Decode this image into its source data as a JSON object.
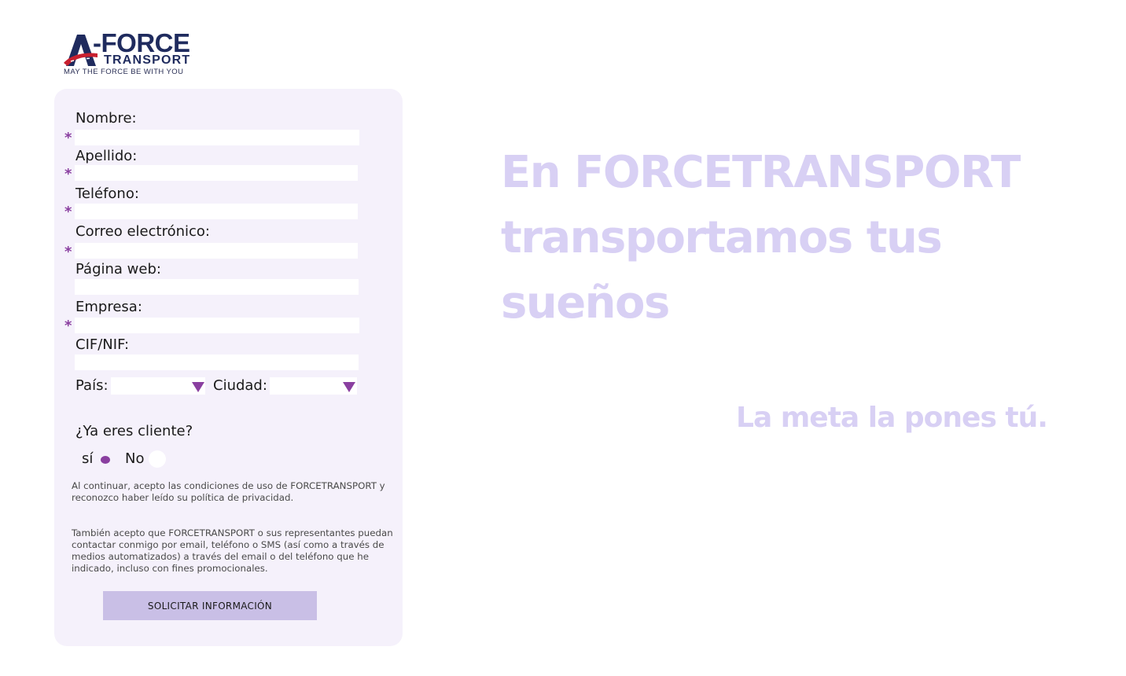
{
  "logo": {
    "brand_word": "-FORCE",
    "sub_word": "TRANSPORT",
    "tagline": "MAY THE FORCE BE WITH YOU"
  },
  "form": {
    "required_mark": "*",
    "fields": {
      "nombre": {
        "label": "Nombre:",
        "value": ""
      },
      "apellido": {
        "label": "Apellido:",
        "value": ""
      },
      "telefono": {
        "label": "Teléfono:",
        "value": ""
      },
      "correo": {
        "label": "Correo electrónico:",
        "value": ""
      },
      "pagina_web": {
        "label": "Página web:",
        "value": ""
      },
      "empresa": {
        "label": "Empresa:",
        "value": ""
      },
      "cif_nif": {
        "label": "CIF/NIF:",
        "value": ""
      }
    },
    "pais": {
      "label": "País:",
      "selected": ""
    },
    "ciudad": {
      "label": "Ciudad:",
      "selected": ""
    },
    "client_question": {
      "label": "¿Ya eres cliente?",
      "option_si": "sí",
      "option_no": "No",
      "selected": "sí"
    },
    "legal_1": "Al continuar, acepto las condiciones de uso de FORCETRANSPORT y reconozco haber leído su política de privacidad.",
    "legal_2": "También acepto que FORCETRANSPORT o sus representantes puedan contactar conmigo por email, teléfono o SMS (así como a través de medios automatizados) a través del email o del teléfono que he indicado, incluso con fines promocionales.",
    "submit_label": "SOLICITAR INFORMACIÓN"
  },
  "hero": {
    "headline": "En FORCETRANSPORT transportamos tus sueños",
    "tagline": "La meta la pones tú."
  },
  "colors": {
    "accent": "#8a3fa0",
    "card_bg": "#f5f1fb",
    "button_bg": "#c9bfe6",
    "hero_text": "#d8d0f4",
    "logo_navy": "#1f2b5e",
    "logo_red": "#c8202f"
  }
}
